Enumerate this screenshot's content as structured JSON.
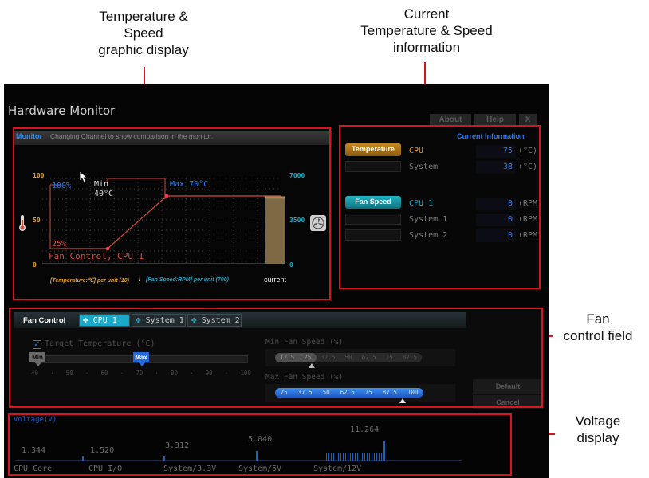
{
  "callouts": {
    "temp_speed_graphic": "Temperature &\nSpeed\ngraphic display",
    "current_info": "Current\nTemperature & Speed\ninformation",
    "fan_control": "Fan\ncontrol field",
    "voltage": "Voltage\ndisplay"
  },
  "app": {
    "title": "Hardware Monitor",
    "buttons": {
      "about": "About",
      "help": "Help",
      "close": "X"
    }
  },
  "monitor": {
    "label": "Monitor",
    "description": "Changing Channel to show comparison in the monitor.",
    "left_axis": [
      "100",
      "50",
      "0"
    ],
    "right_axis": [
      "7000",
      "3500",
      "0"
    ],
    "pct_high": "100%",
    "pct_low": "25%",
    "min_label": "Min",
    "min_temp": "40°C",
    "max_label": "Max 70°C",
    "fan_control_label": "Fan Control, CPU 1",
    "unit_temp": "[Temperature:℃] per unit (10)",
    "separator": "/",
    "unit_fan": "[Fan Speed:RPM] per unit (700)",
    "current_label": "current",
    "current_bar_fraction": 0.79
  },
  "info": {
    "header": "Current Information",
    "temperature_btn": "Temperature",
    "fanspeed_btn": "Fan Speed",
    "temps": [
      {
        "name": "CPU",
        "value": "75",
        "unit": "(°C)"
      },
      {
        "name": "System",
        "value": "38",
        "unit": "(°C)"
      }
    ],
    "fans": [
      {
        "name": "CPU 1",
        "value": "0",
        "unit": "(RPM)"
      },
      {
        "name": "System 1",
        "value": "0",
        "unit": "(RPM)"
      },
      {
        "name": "System 2",
        "value": "0",
        "unit": "(RPM)"
      }
    ]
  },
  "fan_control": {
    "title": "Fan Control",
    "tabs": [
      "CPU 1",
      "System 1",
      "System 2"
    ],
    "target_temp_label": "Target Temperature (°C)",
    "target_checked": true,
    "min_label": "Min",
    "max_label": "Max",
    "temp_ticks": [
      "40",
      "·",
      "50",
      "·",
      "60",
      "·",
      "70",
      "·",
      "80",
      "·",
      "90",
      "·",
      "100"
    ],
    "min_speed_label": "Min Fan Speed (%)",
    "min_speed_ticks": [
      "12.5",
      "25",
      "37.5",
      "50",
      "62.5",
      "75",
      "87.5"
    ],
    "max_speed_label": "Max Fan Speed (%)",
    "max_speed_ticks": [
      "25",
      "37.5",
      "50",
      "62.5",
      "75",
      "87.5",
      "100"
    ],
    "default_btn": "Default",
    "cancel_btn": "Cancel"
  },
  "voltage": {
    "title": "Voltage(V)",
    "items": [
      {
        "name": "CPU Core",
        "value": "1.344"
      },
      {
        "name": "CPU I/O",
        "value": "1.520"
      },
      {
        "name": "System/3.3V",
        "value": "3.312"
      },
      {
        "name": "System/5V",
        "value": "5.040"
      },
      {
        "name": "System/12V",
        "value": "11.264"
      }
    ]
  },
  "colors": {
    "callout_red": "#d6151d",
    "accent_blue": "#1f7fff",
    "accent_cyan": "#1aa9c9",
    "temp_orange": "#e6a02a",
    "curve_red": "#d24a3a",
    "temp_button": "#a26d12",
    "fan_button": "#158e9c"
  }
}
